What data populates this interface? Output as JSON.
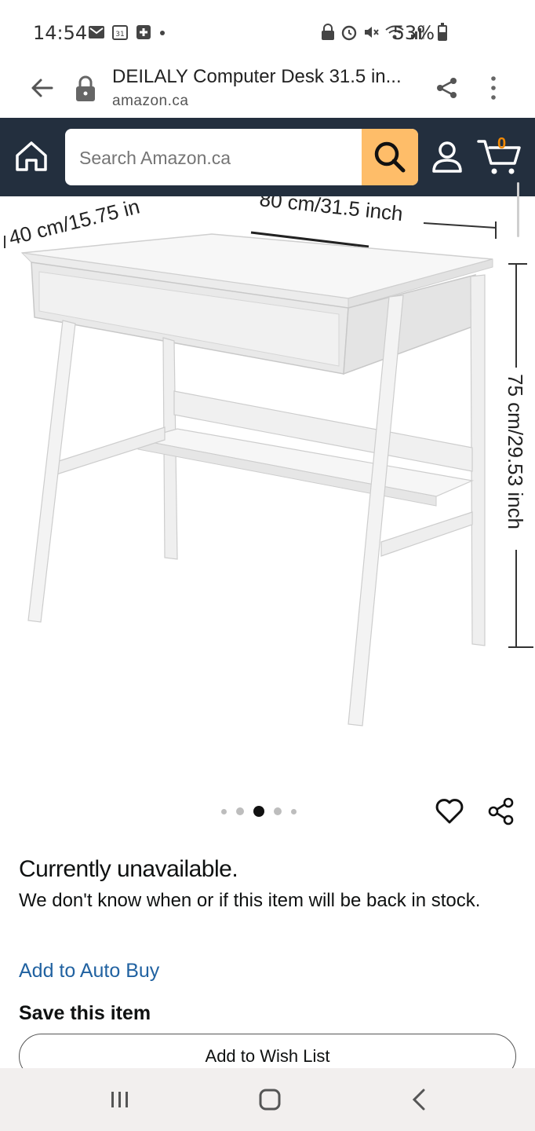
{
  "status_bar": {
    "time": "14:54",
    "battery": "53%",
    "icons": [
      "mail-icon",
      "calendar-icon",
      "health-icon",
      "dot-icon",
      "lock-icon",
      "alarm-icon",
      "mute-icon",
      "wifi-icon",
      "signal-icon",
      "battery-icon"
    ]
  },
  "browser": {
    "title": "DEILALY Computer Desk 31.5 in...",
    "domain": "amazon.ca"
  },
  "header": {
    "search_placeholder": "Search Amazon.ca",
    "cart_count": "0",
    "brand_color": "#232f3e",
    "search_button_color": "#febd69"
  },
  "product_image": {
    "depth_label": "40 cm/15.75 in",
    "width_label": "80 cm/31.5 inch",
    "height_label": "75 cm/29.53 inch"
  },
  "carousel": {
    "dot_count": 5,
    "active_index": 2
  },
  "availability": {
    "title": "Currently unavailable.",
    "message": "We don't know when or if this item will be back in stock."
  },
  "actions": {
    "auto_buy": "Add to Auto Buy",
    "save_heading": "Save this item",
    "wishlist_button": "Add to Wish List"
  }
}
